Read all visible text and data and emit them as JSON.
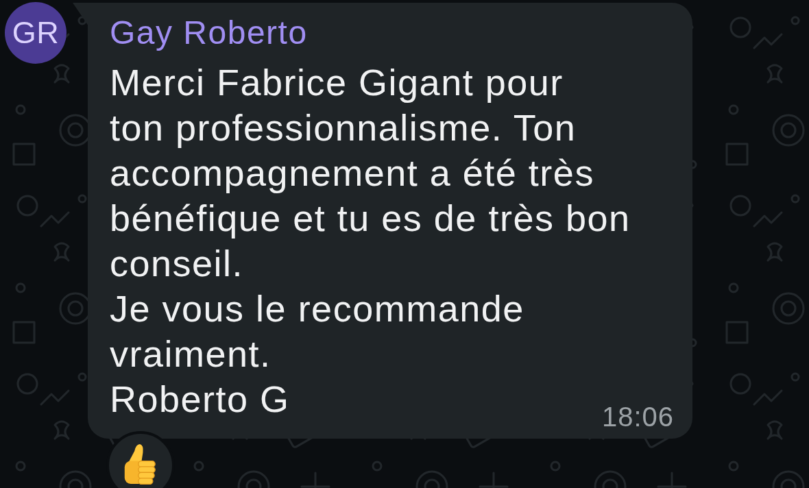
{
  "message": {
    "avatar": {
      "initials": "GR"
    },
    "sender": "Gay Roberto",
    "text_lines": [
      "Merci Fabrice Gigant pour",
      "ton professionnalisme. Ton",
      "accompagnement a été très",
      "bénéfique et tu es de très bon",
      "conseil.",
      "Je vous le recommande",
      "vraiment.",
      "Roberto G"
    ],
    "time": "18:06",
    "reactions": [
      {
        "kind": "thumbs_up"
      }
    ]
  }
}
